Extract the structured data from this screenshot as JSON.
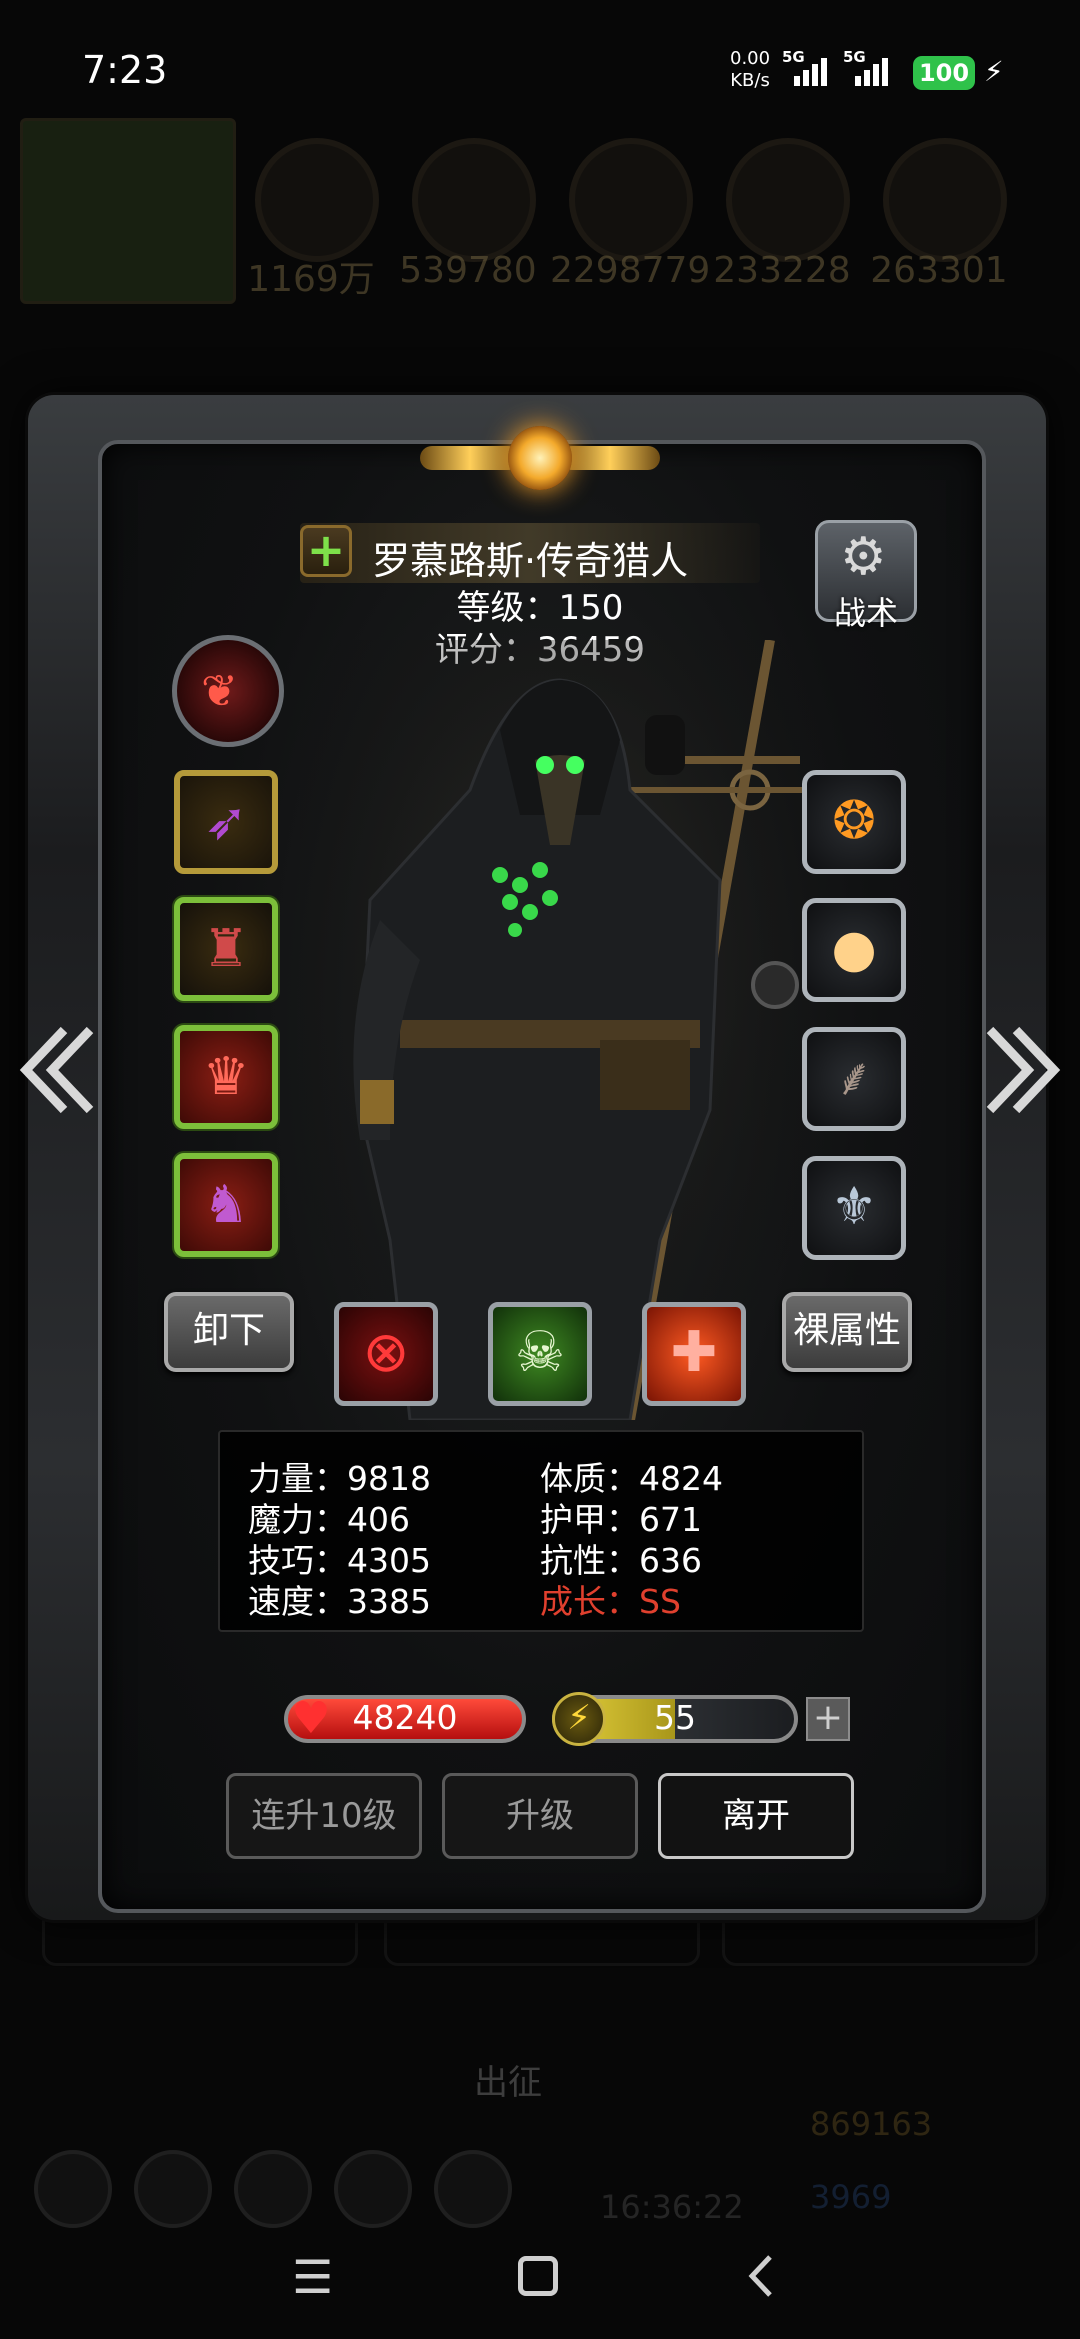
{
  "status_bar": {
    "time": "7:23",
    "net_speed_value": "0.00",
    "net_speed_unit": "KB/s",
    "signal1_label": "5G",
    "signal2_label": "5G",
    "battery": "100"
  },
  "background_resources": {
    "values": [
      "1169万",
      "539780",
      "2298779",
      "233228",
      "263301"
    ],
    "go_label": "出征",
    "gold": "869163",
    "gems": "3969",
    "timer": "16:36:22"
  },
  "hero": {
    "name": "罗慕路斯·传奇猎人",
    "level_text": "等级：150",
    "score_text": "评分：36459",
    "tactics_label": "战术"
  },
  "actions": {
    "unequip_label": "卸下",
    "base_attr_label": "裸属性"
  },
  "stats": {
    "strength": "力量：9818",
    "constitution": "体质：4824",
    "magic": "魔力：406",
    "armor": "护甲：671",
    "skill": "技巧：4305",
    "resistance": "抗性：636",
    "speed": "速度：3385",
    "growth": "成长：SS"
  },
  "vitals": {
    "hp": "48240",
    "energy": "55",
    "energy_fraction": 0.5,
    "energy_plus": "+"
  },
  "buttons": {
    "level_up_10": "连升10级",
    "level_up": "升级",
    "leave": "离开"
  },
  "colors": {
    "growth_red": "#e0402e",
    "battery_green": "#2fc24a",
    "hp_red": "#d42a20",
    "energy_yellow": "#d6c23a"
  },
  "icons": {
    "left_arrow": "double-chevron-left-icon",
    "right_arrow": "double-chevron-right-icon",
    "nav_menu": "menu-icon",
    "nav_home": "home-square-icon",
    "nav_back": "back-icon"
  }
}
